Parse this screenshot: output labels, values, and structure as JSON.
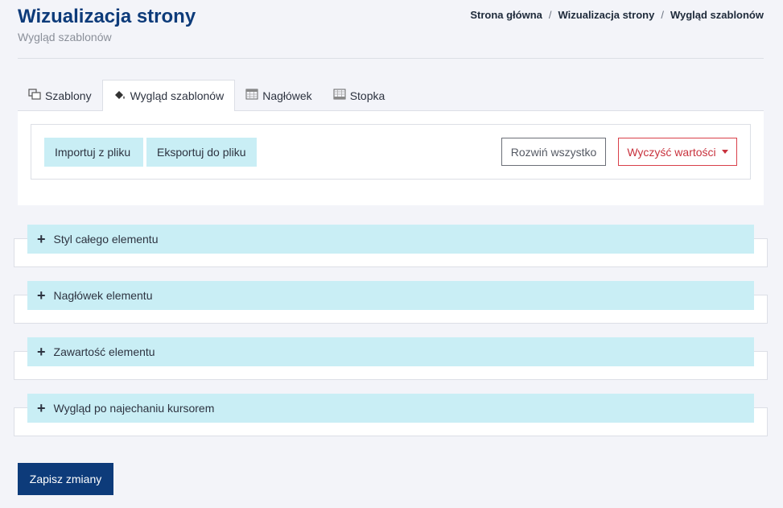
{
  "header": {
    "title": "Wizualizacja strony",
    "subtitle": "Wygląd szablonów"
  },
  "breadcrumb": {
    "items": [
      "Strona główna",
      "Wizualizacja strony",
      "Wygląd szablonów"
    ],
    "separator": "/"
  },
  "tabs": [
    {
      "label": "Szablony",
      "icon": "templates-icon",
      "active": false
    },
    {
      "label": "Wygląd szablonów",
      "icon": "paint-bucket-icon",
      "active": true
    },
    {
      "label": "Nagłówek",
      "icon": "header-grid-icon",
      "active": false
    },
    {
      "label": "Stopka",
      "icon": "footer-grid-icon",
      "active": false
    }
  ],
  "toolbar": {
    "import_label": "Importuj z pliku",
    "export_label": "Eksportuj do pliku",
    "expand_label": "Rozwiń wszystko",
    "clear_label": "Wyczyść wartości"
  },
  "sections": [
    {
      "label": "Styl całego elementu"
    },
    {
      "label": "Nagłówek elementu"
    },
    {
      "label": "Zawartość elementu"
    },
    {
      "label": "Wygląd po najechaniu kursorem"
    }
  ],
  "actions": {
    "save_label": "Zapisz zmiany"
  },
  "colors": {
    "primary": "#0d3b7a",
    "info": "#c9eef5",
    "danger": "#c8323d",
    "background": "#f3f4f9"
  }
}
